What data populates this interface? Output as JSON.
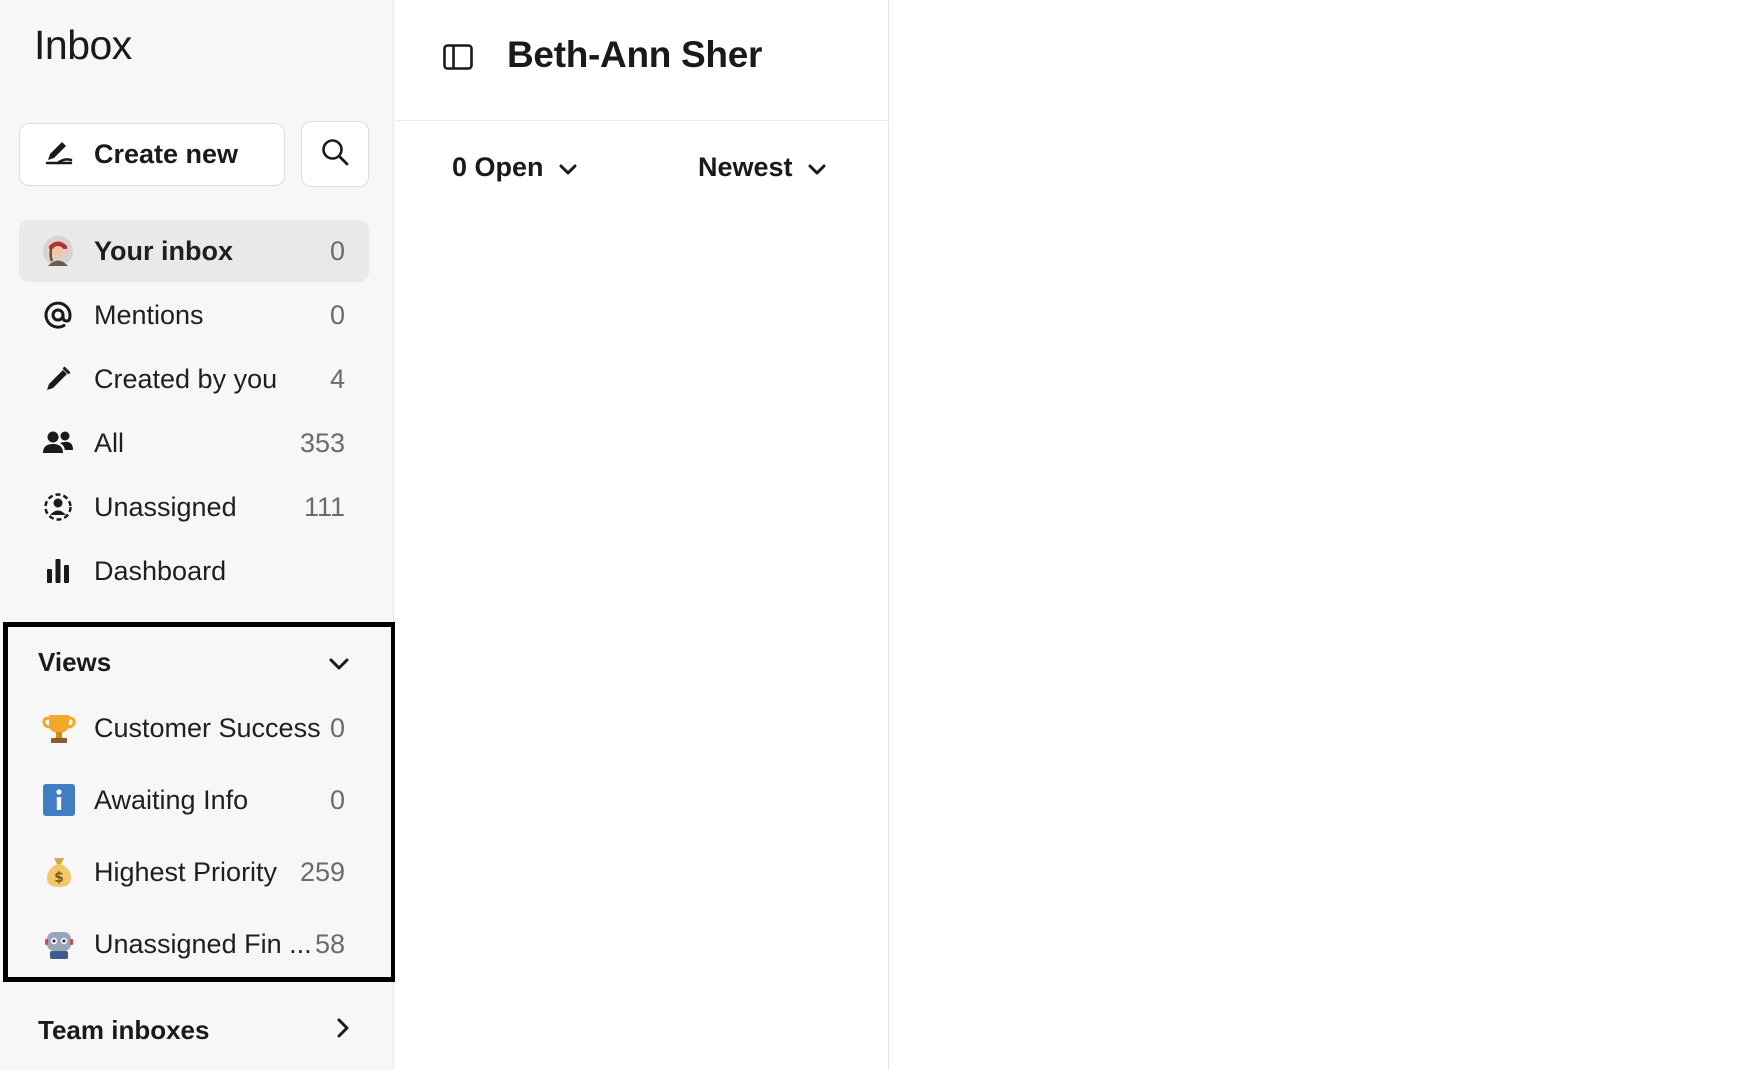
{
  "sidebar": {
    "title": "Inbox",
    "create_label": "Create new",
    "nav": [
      {
        "label": "Your inbox",
        "count": "0",
        "icon": "avatar"
      },
      {
        "label": "Mentions",
        "count": "0",
        "icon": "at-icon"
      },
      {
        "label": "Created by you",
        "count": "4",
        "icon": "pencil-icon"
      },
      {
        "label": "All",
        "count": "353",
        "icon": "people-icon"
      },
      {
        "label": "Unassigned",
        "count": "111",
        "icon": "unassigned-icon"
      },
      {
        "label": "Dashboard",
        "count": "",
        "icon": "bar-chart-icon"
      }
    ],
    "views": {
      "title": "Views",
      "items": [
        {
          "label": "Customer Success",
          "count": "0",
          "icon": "trophy-icon"
        },
        {
          "label": "Awaiting Info",
          "count": "0",
          "icon": "info-icon"
        },
        {
          "label": "Highest Priority",
          "count": "259",
          "icon": "money-bag-icon"
        },
        {
          "label": "Unassigned Fin ...",
          "count": "58",
          "icon": "robot-icon"
        }
      ]
    },
    "team": {
      "title": "Team inboxes"
    }
  },
  "list": {
    "title": "Beth-Ann Sher",
    "status_filter": "0 Open",
    "sort_filter": "Newest"
  },
  "colors": {
    "sidebar_bg": "#f7f7f7",
    "active_bg": "#e9e9e9",
    "highlight_border": "#000000",
    "info_blue": "#3f7ec2",
    "trophy_gold": "#f2a829"
  }
}
